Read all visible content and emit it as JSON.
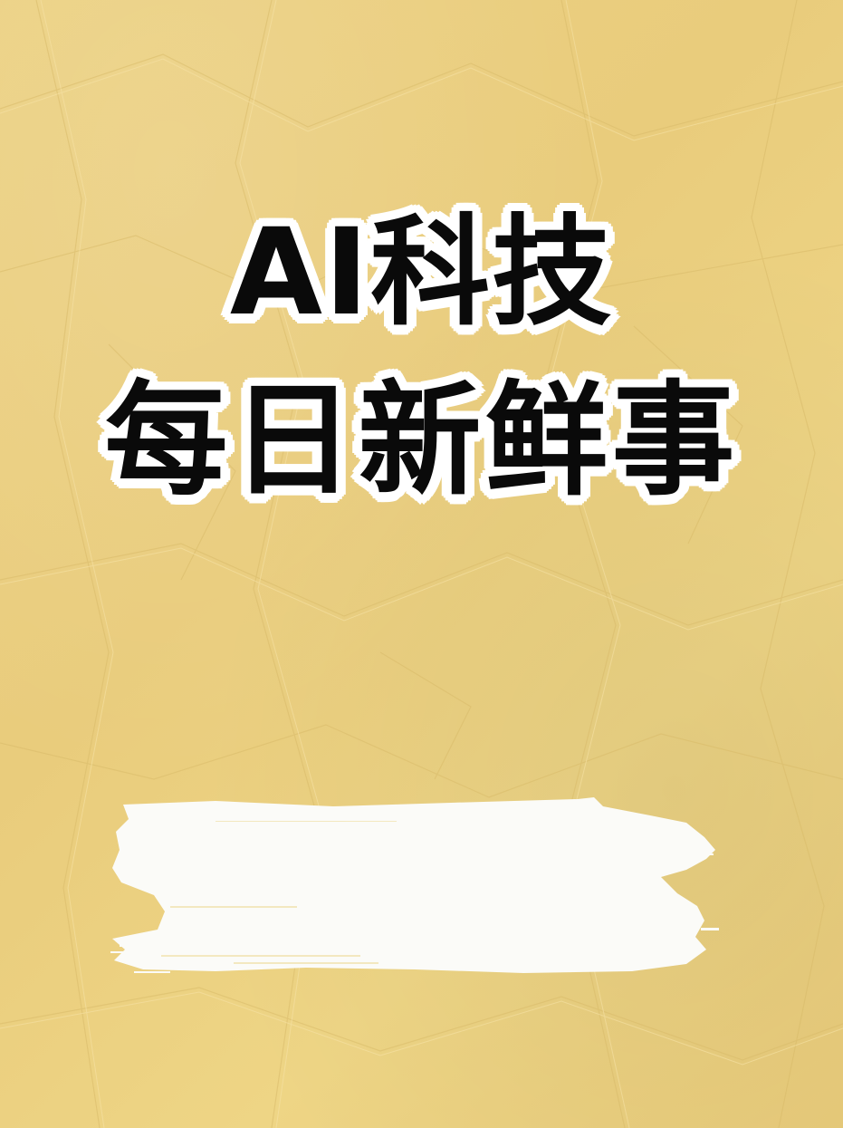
{
  "poster": {
    "title_line_1": "AI科技",
    "title_line_2": "每日新鲜事"
  },
  "colors": {
    "background": "#ecd183",
    "title_text": "#0a0a0a",
    "title_outline": "#ffffff",
    "brush": "#fbfbf8"
  },
  "decorations": {
    "background_icon": "crumpled-paper-texture",
    "brush_icon": "white-paint-brush-stroke"
  }
}
